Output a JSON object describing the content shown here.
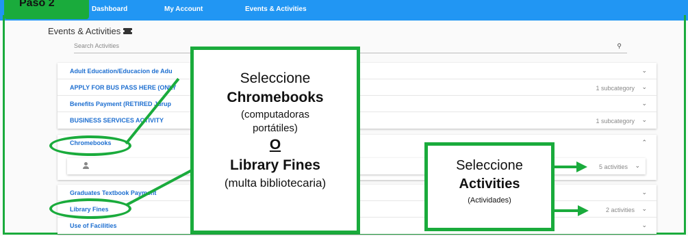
{
  "nav": {
    "step_badge": "Paso 2",
    "dashboard": "Dashboard",
    "my_account": "My Account",
    "events": "Events & Activities"
  },
  "page": {
    "title": "Events & Activities"
  },
  "search": {
    "placeholder": "Search Activities"
  },
  "categories": [
    {
      "label": "Adult Education/Educacion de Adu",
      "meta": ""
    },
    {
      "label": "APPLY FOR BUS PASS HERE (ONLY",
      "meta": "1 subcategory"
    },
    {
      "label": "Benefits Payment (RETIRED Jurup",
      "meta": ""
    },
    {
      "label": "BUSINESS SERVICES ACTIVITY",
      "meta": "1 subcategory"
    }
  ],
  "chromebooks": {
    "label": "Chromebooks",
    "activities": "5 activities"
  },
  "lower": [
    {
      "label": "Graduates Textbook Payment",
      "meta": ""
    },
    {
      "label": "Library Fines",
      "meta": "2 activities"
    },
    {
      "label": "Use of Facilities",
      "meta": ""
    }
  ],
  "callout_main": {
    "line1": "Seleccione",
    "line2": "Chromebooks",
    "line3": "(computadoras",
    "line4": "portátiles)",
    "line5": "O",
    "line6": "Library Fines",
    "line7": "(multa bibliotecaria)"
  },
  "callout_act": {
    "line1": "Seleccione",
    "line2": "Activities",
    "line3": "(Actividades)"
  },
  "colors": {
    "nav": "#2196f3",
    "accent": "#1aab3c",
    "link": "#1e6fd0"
  }
}
